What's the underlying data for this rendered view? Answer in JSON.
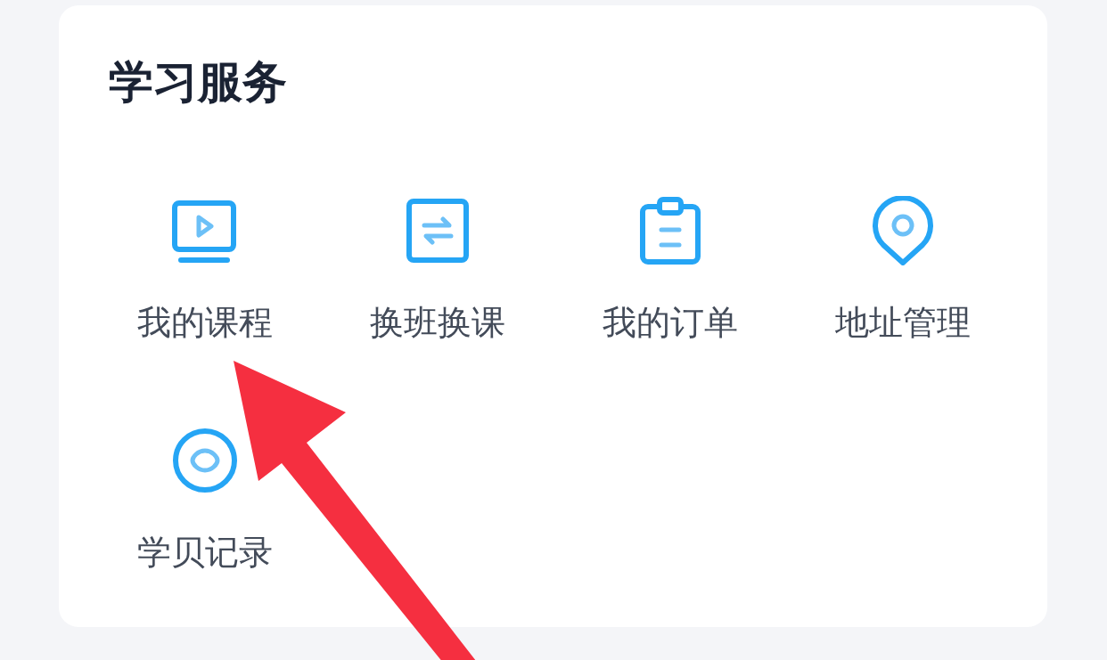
{
  "section": {
    "title": "学习服务"
  },
  "items": [
    {
      "label": "我的课程"
    },
    {
      "label": "换班换课"
    },
    {
      "label": "我的订单"
    },
    {
      "label": "地址管理"
    },
    {
      "label": "学贝记录"
    }
  ]
}
